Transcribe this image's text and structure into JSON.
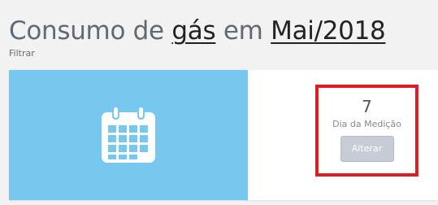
{
  "header": {
    "prefix": "Consumo de",
    "resource": "gás",
    "middle": "em",
    "period": "Mai/2018"
  },
  "filter": {
    "label": "Filtrar"
  },
  "card": {
    "icon": "calendar-icon",
    "panel_color": "#76c8ef",
    "highlight_color": "#e11b22",
    "value": "7",
    "label": "Dia da Medição",
    "button_label": "Alterar"
  }
}
